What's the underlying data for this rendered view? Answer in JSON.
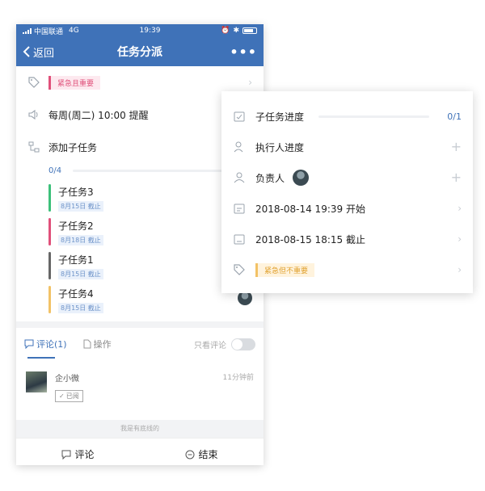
{
  "status_bar": {
    "carrier": "中国联通",
    "network": "4G",
    "time": "19:39"
  },
  "navbar": {
    "back_label": "返回",
    "title": "任务分派",
    "more_label": "•••"
  },
  "task": {
    "tag": "紧急且重要",
    "reminder": "每周(周二) 10:00 提醒",
    "add_subtask": "添加子任务",
    "progress": "0/4",
    "subtasks": [
      {
        "title": "子任务3",
        "due": "8月15日 截止",
        "color": "#3cc07a"
      },
      {
        "title": "子任务2",
        "due": "8月18日 截止",
        "color": "#e0507a"
      },
      {
        "title": "子任务1",
        "due": "8月15日 截止",
        "color": "#666666"
      },
      {
        "title": "子任务4",
        "due": "8月15日 截止",
        "color": "#f2c266"
      }
    ]
  },
  "tabs": {
    "comments": "评论(1)",
    "operations": "操作",
    "only_comments": "只看评论"
  },
  "comment": {
    "author": "企小微",
    "time": "11分钟前",
    "read": "已阅"
  },
  "bottom_line": "我是有底线的",
  "footer": {
    "comment": "评论",
    "finish": "结束"
  },
  "popover": {
    "subtask_progress_label": "子任务进度",
    "subtask_progress_value": "0/1",
    "executor_progress": "执行人进度",
    "owner": "负责人",
    "start": "2018-08-14 19:39 开始",
    "due": "2018-08-15 18:15 截止",
    "tag": "紧急但不重要"
  },
  "colors": {
    "brand": "#3f72b8",
    "urgent_red": "#e0507a",
    "urgent_yellow": "#f2c266"
  }
}
